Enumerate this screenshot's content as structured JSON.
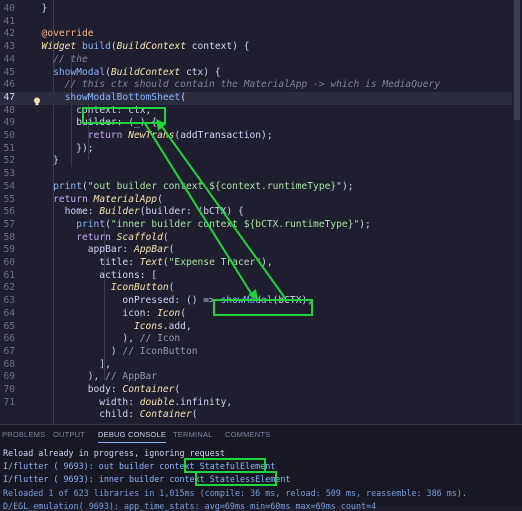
{
  "editor": {
    "line_numbers": [
      "40",
      "41",
      "42",
      "43",
      "44",
      "45",
      "46",
      "47",
      "48",
      "49",
      "50",
      "51",
      "52",
      "53",
      "54",
      "55",
      "56",
      "57",
      "58",
      "59",
      "60",
      "61",
      "62",
      "63",
      "64",
      "65",
      "66",
      "67",
      "68",
      "69",
      "70",
      "71"
    ],
    "lines": [
      [
        {
          "t": "  }",
          "c": "id"
        }
      ],
      [],
      [
        {
          "t": "  @override",
          "c": "ann"
        }
      ],
      [
        {
          "t": "  Widget ",
          "c": "cls"
        },
        {
          "t": "build",
          "c": "fn"
        },
        {
          "t": "(",
          "c": "id"
        },
        {
          "t": "BuildContext",
          "c": "cls"
        },
        {
          "t": " context) {",
          "c": "id"
        }
      ],
      [
        {
          "t": "    // the",
          "c": "cm"
        }
      ],
      [
        {
          "t": "    ",
          "c": "id"
        },
        {
          "t": "showModal",
          "c": "fn"
        },
        {
          "t": "(",
          "c": "id"
        },
        {
          "t": "BuildContext",
          "c": "cls"
        },
        {
          "t": " ctx) {",
          "c": "id"
        }
      ],
      [
        {
          "t": "      // this ctx should contain the MaterialApp -> which is MediaQuery",
          "c": "cm"
        }
      ],
      [
        {
          "t": "      ",
          "c": "id"
        },
        {
          "t": "showModalBottomSheet",
          "c": "fn"
        },
        {
          "t": "(",
          "c": "id"
        }
      ],
      [
        {
          "t": "        ",
          "c": "id"
        },
        {
          "t": "context",
          "c": "id"
        },
        {
          "t": ": ctx,",
          "c": "id"
        }
      ],
      [
        {
          "t": "        builder: (_) {",
          "c": "id"
        }
      ],
      [
        {
          "t": "          ",
          "c": "id"
        },
        {
          "t": "return ",
          "c": "kw"
        },
        {
          "t": "NewTrans",
          "c": "cls"
        },
        {
          "t": "(addTransaction);",
          "c": "id"
        }
      ],
      [
        {
          "t": "        });",
          "c": "id"
        }
      ],
      [
        {
          "t": "    }",
          "c": "id"
        }
      ],
      [],
      [
        {
          "t": "    ",
          "c": "id"
        },
        {
          "t": "print",
          "c": "fn"
        },
        {
          "t": "(",
          "c": "id"
        },
        {
          "t": "\"out builder context ${context.runtimeType}\"",
          "c": "str"
        },
        {
          "t": ");",
          "c": "id"
        }
      ],
      [
        {
          "t": "    ",
          "c": "id"
        },
        {
          "t": "return ",
          "c": "kw"
        },
        {
          "t": "MaterialApp",
          "c": "cls"
        },
        {
          "t": "(",
          "c": "id"
        }
      ],
      [
        {
          "t": "      home: ",
          "c": "id"
        },
        {
          "t": "Builder",
          "c": "cls"
        },
        {
          "t": "(builder: (bCTX) {",
          "c": "id"
        }
      ],
      [
        {
          "t": "        ",
          "c": "id"
        },
        {
          "t": "print",
          "c": "fn"
        },
        {
          "t": "(",
          "c": "id"
        },
        {
          "t": "\"inner builder context ${bCTX.runtimeType}\"",
          "c": "str"
        },
        {
          "t": ");",
          "c": "id"
        }
      ],
      [
        {
          "t": "        ",
          "c": "id"
        },
        {
          "t": "return ",
          "c": "kw"
        },
        {
          "t": "Scaffold",
          "c": "cls"
        },
        {
          "t": "(",
          "c": "id"
        }
      ],
      [
        {
          "t": "          appBar: ",
          "c": "id"
        },
        {
          "t": "AppBar",
          "c": "cls"
        },
        {
          "t": "(",
          "c": "id"
        }
      ],
      [
        {
          "t": "            title: ",
          "c": "id"
        },
        {
          "t": "Text",
          "c": "cls"
        },
        {
          "t": "(",
          "c": "id"
        },
        {
          "t": "\"Expense Tracer\"",
          "c": "str"
        },
        {
          "t": "),",
          "c": "id"
        }
      ],
      [
        {
          "t": "            actions: [",
          "c": "id"
        }
      ],
      [
        {
          "t": "              ",
          "c": "id"
        },
        {
          "t": "IconButton",
          "c": "cls"
        },
        {
          "t": "(",
          "c": "id"
        }
      ],
      [
        {
          "t": "                onPressed: () => ",
          "c": "id"
        },
        {
          "t": "showModal",
          "c": "fn"
        },
        {
          "t": "(bCTX),",
          "c": "id"
        }
      ],
      [
        {
          "t": "                icon: ",
          "c": "id"
        },
        {
          "t": "Icon",
          "c": "cls"
        },
        {
          "t": "(",
          "c": "id"
        }
      ],
      [
        {
          "t": "                  ",
          "c": "id"
        },
        {
          "t": "Icons",
          "c": "cls"
        },
        {
          "t": ".add,",
          "c": "id"
        }
      ],
      [
        {
          "t": "                ), ",
          "c": "id"
        },
        {
          "t": "// Icon",
          "c": "cmt2"
        }
      ],
      [
        {
          "t": "              ) ",
          "c": "id"
        },
        {
          "t": "// IconButton",
          "c": "cmt2"
        }
      ],
      [
        {
          "t": "            ],",
          "c": "id"
        }
      ],
      [
        {
          "t": "          ), ",
          "c": "id"
        },
        {
          "t": "// AppBar",
          "c": "cmt2"
        }
      ],
      [
        {
          "t": "          body: ",
          "c": "id"
        },
        {
          "t": "Container",
          "c": "cls"
        },
        {
          "t": "(",
          "c": "id"
        }
      ],
      [
        {
          "t": "            width: ",
          "c": "id"
        },
        {
          "t": "double",
          "c": "cls"
        },
        {
          "t": ".infinity,",
          "c": "id"
        }
      ],
      [
        {
          "t": "            child: ",
          "c": "id"
        },
        {
          "t": "Container",
          "c": "cls"
        },
        {
          "t": "(",
          "c": "id"
        }
      ]
    ]
  },
  "panel": {
    "tabs": [
      "PROBLEMS",
      "OUTPUT",
      "DEBUG CONSOLE",
      "TERMINAL",
      "COMMENTS"
    ],
    "active_tab": "DEBUG CONSOLE",
    "output": [
      "Reload already in progress, ignoring request",
      "I/flutter ( 9693): out builder context StatefulElement",
      "I/flutter ( 9693): inner builder context StatelessElement",
      "Reloaded 1 of 623 libraries in 1,015ms (compile: 36 ms, reload: 509 ms, reassemble: 386 ms).",
      "D/EGL_emulation( 9693): app_time_stats: avg=69ms min=60ms max=69ms count=4"
    ]
  },
  "colors": {
    "annotation": "#21d33b",
    "background": "#1e1e2e",
    "panel": "#181825"
  }
}
